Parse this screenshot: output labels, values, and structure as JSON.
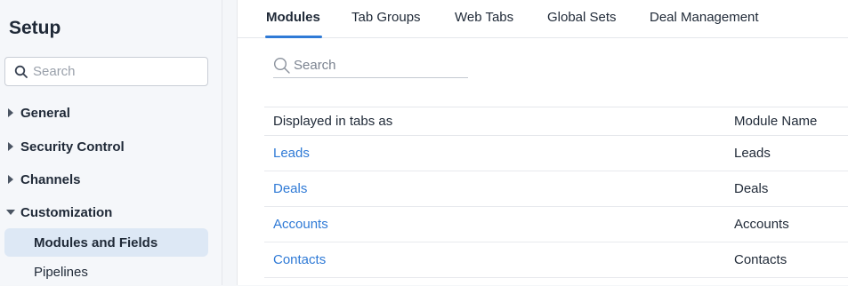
{
  "sidebar": {
    "title": "Setup",
    "search_placeholder": "Search",
    "items": [
      {
        "label": "General",
        "expanded": false
      },
      {
        "label": "Security Control",
        "expanded": false
      },
      {
        "label": "Channels",
        "expanded": false
      },
      {
        "label": "Customization",
        "expanded": true
      }
    ],
    "subitems": [
      {
        "label": "Modules and Fields",
        "active": true
      },
      {
        "label": "Pipelines",
        "active": false
      }
    ]
  },
  "main": {
    "tabs": [
      {
        "label": "Modules",
        "active": true
      },
      {
        "label": "Tab Groups",
        "active": false
      },
      {
        "label": "Web Tabs",
        "active": false
      },
      {
        "label": "Global Sets",
        "active": false
      },
      {
        "label": "Deal Management",
        "active": false
      }
    ],
    "search_placeholder": "Search",
    "table": {
      "headers": [
        "Displayed in tabs as",
        "Module Name"
      ],
      "rows": [
        {
          "tab": "Leads",
          "module": "Leads"
        },
        {
          "tab": "Deals",
          "module": "Deals"
        },
        {
          "tab": "Accounts",
          "module": "Accounts"
        },
        {
          "tab": "Contacts",
          "module": "Contacts"
        }
      ]
    }
  },
  "colors": {
    "accent": "#2f7ad6",
    "active_background": "#dde8f5"
  },
  "icons": {
    "search": "search-icon",
    "collapsed": "caret-right-icon",
    "expanded": "caret-down-icon"
  }
}
